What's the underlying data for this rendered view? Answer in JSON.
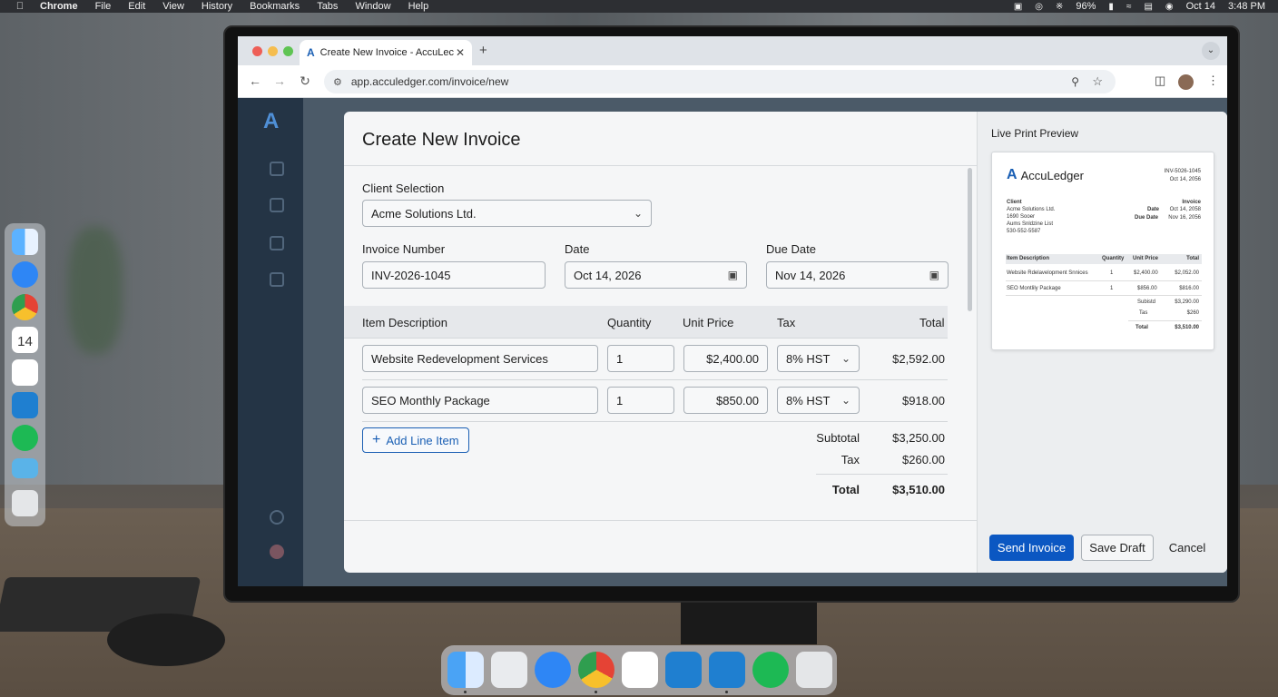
{
  "menubar": {
    "app": "Chrome",
    "items": [
      "File",
      "Edit",
      "View",
      "History",
      "Bookmarks",
      "Tabs",
      "Window",
      "Help"
    ],
    "battery": "96%",
    "date": "Oct 14",
    "time": "3:48 PM"
  },
  "browser": {
    "tab_title": "Create New Invoice - AccuLec",
    "url": "app.acculedger.com/invoice/new"
  },
  "modal": {
    "title": "Create New Invoice",
    "client_label": "Client Selection",
    "client_value": "Acme Solutions Ltd.",
    "invoice_number_label": "Invoice Number",
    "invoice_number_value": "INV-2026-1045",
    "date_label": "Date",
    "date_value": "Oct 14, 2026",
    "due_date_label": "Due Date",
    "due_date_value": "Nov 14, 2026",
    "table_headers": {
      "description": "Item Description",
      "quantity": "Quantity",
      "unit_price": "Unit Price",
      "tax": "Tax",
      "total": "Total"
    },
    "line_items": [
      {
        "description": "Website Redevelopment Services",
        "quantity": "1",
        "unit_price": "$2,400.00",
        "tax": "8% HST",
        "total": "$2,592.00"
      },
      {
        "description": "SEO Monthly Package",
        "quantity": "1",
        "unit_price": "$850.00",
        "tax": "8% HST",
        "total": "$918.00"
      }
    ],
    "add_line_label": "Add Line Item",
    "summary": {
      "subtotal_label": "Subtotal",
      "subtotal_value": "$3,250.00",
      "tax_label": "Tax",
      "tax_value": "$260.00",
      "total_label": "Total",
      "total_value": "$3,510.00"
    },
    "buttons": {
      "send": "Send Invoice",
      "save": "Save Draft",
      "cancel": "Cancel"
    }
  },
  "preview": {
    "title": "Live Print Preview",
    "brand": "AccuLedger",
    "invoice_no": "INV-5026-1045",
    "invoice_date": "Oct 14, 2056",
    "client_label": "Client",
    "client_lines": [
      "Acme Solutions Ltd.",
      "1690 Sooer",
      "Aums Snldzine List",
      "530-552-5587"
    ],
    "meta_title": "Invoice",
    "date_label": "Date",
    "date_value": "Oct 14, 2058",
    "due_label": "Due Date",
    "due_value": "Nov 16, 2056",
    "headers": [
      "Item Description",
      "Quantity",
      "Unit Price",
      "Total"
    ],
    "rows": [
      {
        "desc": "Website Rdelavelopment Snnices",
        "qty": "1",
        "price": "$2,400.00",
        "total": "$2,052.00"
      },
      {
        "desc": "SEO Montlily Package",
        "qty": "1",
        "price": "$856.00",
        "total": "$816.00"
      }
    ],
    "subtotal_label": "Subistd",
    "subtotal_value": "$3,290.00",
    "tax_label": "Tas",
    "tax_value": "$260",
    "total_label": "Total",
    "total_value": "$3,510.00"
  },
  "dock_apps": [
    "finder-icon",
    "launchpad-icon",
    "safari-icon",
    "chrome-icon",
    "slack-icon",
    "vscode-icon",
    "vscode-icon",
    "spotify-icon",
    "trash-icon"
  ],
  "side_dock_apps": [
    "finder-icon",
    "safari-icon",
    "chrome-icon",
    "calendar-icon",
    "slack-icon",
    "vscode-icon",
    "spotify-icon",
    "folder-icon",
    "trash-icon"
  ],
  "calendar_day": "14",
  "colors": {
    "primary": "#0b57c2",
    "brand": "#1a5fb4"
  }
}
